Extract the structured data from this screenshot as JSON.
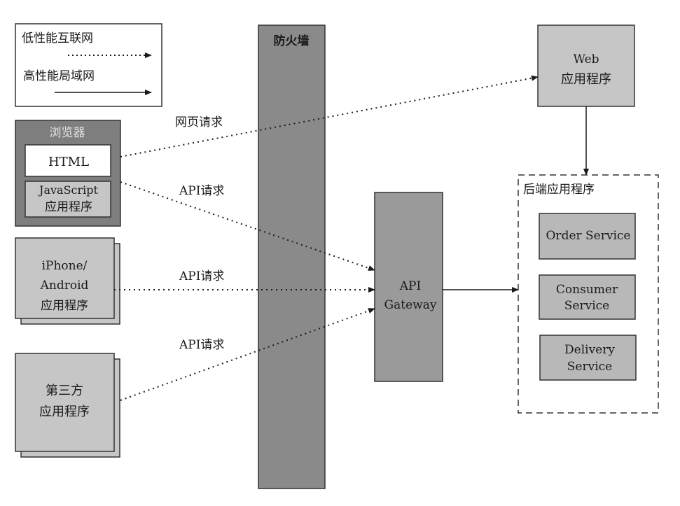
{
  "legend": {
    "low_perf_label": "低性能互联网",
    "high_perf_label": "高性能局域网"
  },
  "firewall": {
    "label": "防火墙"
  },
  "browser": {
    "label": "浏览器",
    "html_label": "HTML",
    "js_line1": "JavaScript",
    "js_line2": "应用程序"
  },
  "mobile": {
    "line1": "iPhone/",
    "line2": "Android",
    "line3": "应用程序"
  },
  "third_party": {
    "line1": "第三方",
    "line2": "应用程序"
  },
  "web_app": {
    "line1": "Web",
    "line2": "应用程序"
  },
  "api_gateway": {
    "line1": "API",
    "line2": "Gateway"
  },
  "backend": {
    "label": "后端应用程序",
    "services": [
      {
        "line1": "Order Service",
        "line2": ""
      },
      {
        "line1": "Consumer",
        "line2": "Service"
      },
      {
        "line1": "Delivery",
        "line2": "Service"
      }
    ]
  },
  "edges": {
    "web_request": "网页请求",
    "api_request_js": "API请求",
    "api_request_mobile": "API请求",
    "api_request_third": "API请求"
  },
  "colors": {
    "firewall": "#8a8a8a",
    "browser": "#7e7e7e",
    "component": "#c6c6c6",
    "gateway": "#9a9a9a",
    "service": "#b8b8b8"
  }
}
